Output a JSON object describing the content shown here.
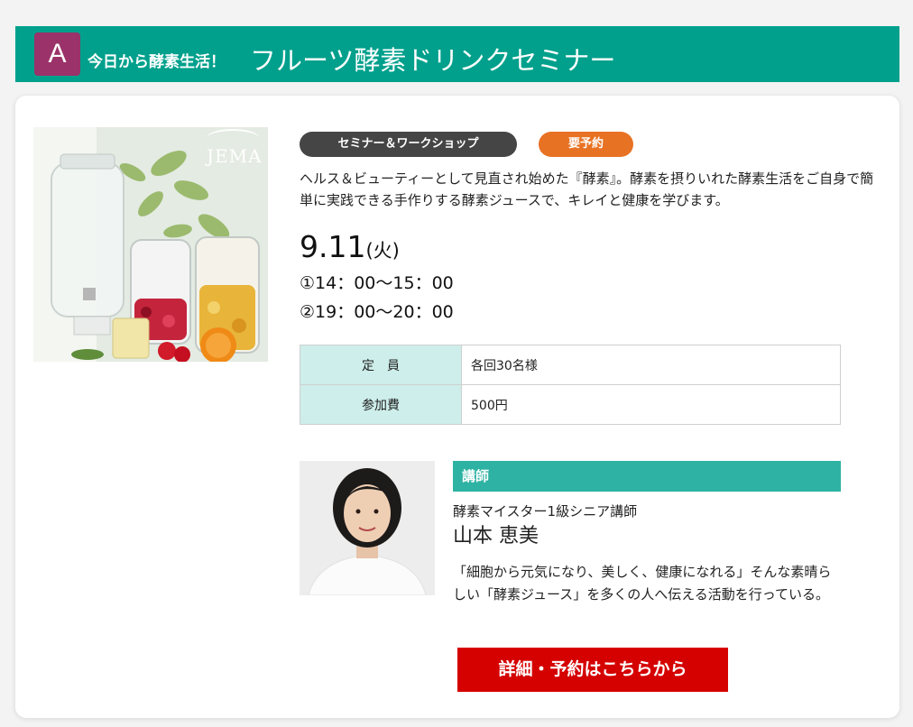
{
  "header": {
    "badge": "A",
    "subtitle": "今日から酵素生活！",
    "title": "フルーツ酵素ドリンクセミナー"
  },
  "product": {
    "image_label": "JEMA"
  },
  "tags": {
    "category": "セミナー＆ワークショップ",
    "reservation": "要予約"
  },
  "description": "ヘルス＆ビューティーとして見直され始めた『酵素』。酵素を摂りいれた酵素生活をご自身で簡単に実践できる手作りする酵素ジュースで、キレイと健康を学びます。",
  "schedule": {
    "date": "9.11",
    "day_of_week": "(火)",
    "times": [
      "①14：00～15：00",
      "②19：00～20：00"
    ]
  },
  "info": {
    "rows": [
      {
        "label": "定　員",
        "value": "各回30名様"
      },
      {
        "label": "参加費",
        "value": "500円"
      }
    ]
  },
  "lecturer": {
    "heading": "講師",
    "role": "酵素マイスター1級シニア講師",
    "name": "山本 恵美",
    "bio": "「細胞から元気になり、美しく、健康になれる」そんな素晴らしい「酵素ジュース」を多くの人へ伝える活動を行っている。"
  },
  "cta": {
    "label": "詳細・予約はこちらから"
  },
  "colors": {
    "header_bg": "#00a08c",
    "badge_bg": "#9b3269",
    "tag_dark": "#454545",
    "tag_orange": "#e87223",
    "table_head_bg": "#cdeeea",
    "lecturer_head_bg": "#2db2a3",
    "cta_bg": "#d50000"
  }
}
